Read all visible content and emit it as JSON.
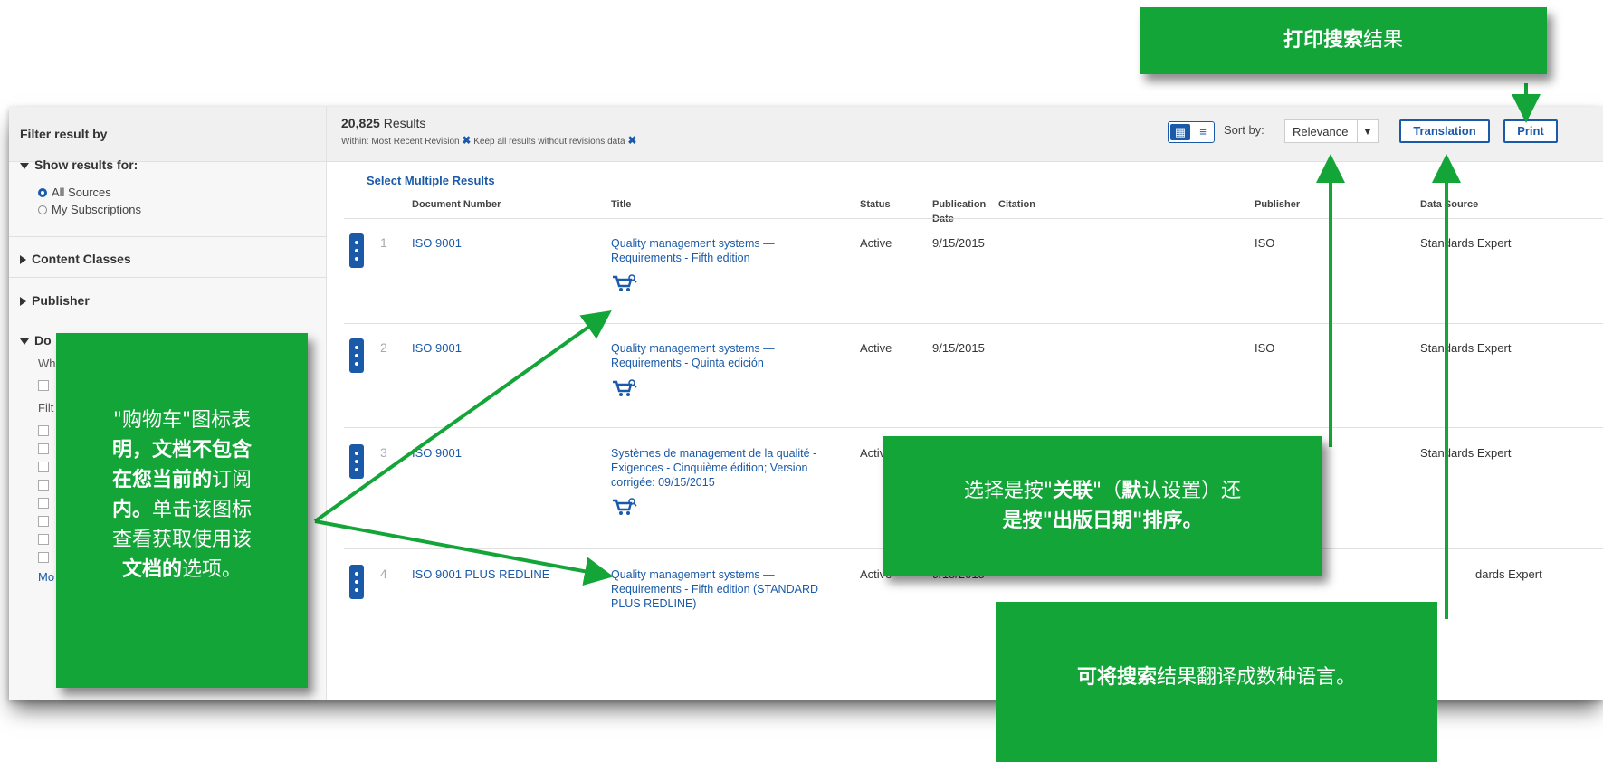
{
  "sidebar": {
    "header": "Filter result by",
    "show_results_for": "Show results for:",
    "sources": [
      {
        "label": "All Sources",
        "selected": true
      },
      {
        "label": "My Subscriptions",
        "selected": false
      }
    ],
    "content_classes": "Content Classes",
    "publisher": "Publisher",
    "section_fragment": "Do",
    "frag_wh": "Wh",
    "frag_filt": "Filt",
    "frag_more": "Mo"
  },
  "toolbar": {
    "results_count": "20,825",
    "results_label": "Results",
    "within_text": "Within: Most Recent Revision",
    "keep_text": "Keep all results without revisions data",
    "grid_icon": "grid-view-icon",
    "list_icon": "list-view-icon",
    "sort_by": "Sort by:",
    "sort_value": "Relevance",
    "translation": "Translation",
    "print": "Print"
  },
  "results": {
    "select_multiple": "Select Multiple Results",
    "columns": {
      "doc_number": "Document Number",
      "title": "Title",
      "status": "Status",
      "pub_date_1": "Publication",
      "pub_date_2": "Date",
      "citation": "Citation",
      "publisher": "Publisher",
      "data_source": "Data Source"
    },
    "rows": [
      {
        "num": "1",
        "doc": "ISO 9001",
        "title_1": "Quality management systems —",
        "title_2": "Requirements - Fifth edition",
        "title_3": "",
        "status": "Active",
        "date": "9/15/2015",
        "publisher": "ISO",
        "source": "Standards Expert"
      },
      {
        "num": "2",
        "doc": "ISO 9001",
        "title_1": "Quality management systems —",
        "title_2": "Requirements - Quinta edición",
        "title_3": "",
        "status": "Active",
        "date": "9/15/2015",
        "publisher": "ISO",
        "source": "Standards Expert"
      },
      {
        "num": "3",
        "doc": "ISO 9001",
        "title_1": "Systèmes de management de la qualité -",
        "title_2": "Exigences - Cinquième édition; Version",
        "title_3": "corrigée: 09/15/2015",
        "status": "Active",
        "date": "",
        "publisher": "",
        "source": "Standards Expert"
      },
      {
        "num": "4",
        "doc": "ISO 9001 PLUS REDLINE",
        "title_1": "Quality management systems —",
        "title_2": "Requirements - Fifth edition (STANDARD",
        "title_3": "PLUS REDLINE)",
        "status": "Active",
        "date": "9/15/2015",
        "publisher": "",
        "source": "dards Expert"
      }
    ]
  },
  "callouts": {
    "top_a": "打印搜索",
    "top_b": "结果",
    "left_a": "\"购物车\"图标表",
    "left_b": "明，文档不包含",
    "left_c": "在您当前的",
    "left_d": "订阅",
    "left_e": "内。",
    "left_f": "单击该图标",
    "left_g": "查看获取使用该",
    "left_h": "文档的",
    "left_i": "选项。",
    "mid_a": "选择是按\"",
    "mid_b": "关联",
    "mid_c": "\"（",
    "mid_d": "默",
    "mid_e": "认设置）还",
    "mid_f": "是按\"出版日期\"排序。",
    "bot_a": "可将搜索",
    "bot_b": "结果翻译成数种语言。"
  },
  "colors": {
    "accent_blue": "#1a5aa8",
    "callout_green": "#13a538"
  }
}
